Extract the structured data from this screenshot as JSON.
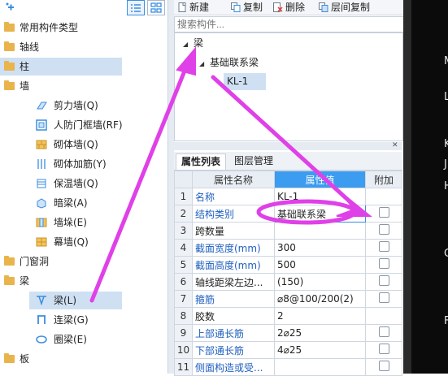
{
  "left_tree": {
    "top_buttons": [
      "plus-icon",
      "list-view-icon",
      "grid-view-icon"
    ],
    "items": [
      {
        "label": "常用构件类型",
        "level": 0,
        "icon": "folder-icon"
      },
      {
        "label": "轴线",
        "level": 0,
        "icon": "folder-icon"
      },
      {
        "label": "柱",
        "level": 0,
        "icon": "folder-icon",
        "selected": true
      },
      {
        "label": "墙",
        "level": 0,
        "icon": "folder-icon"
      },
      {
        "label": "剪力墙(Q)",
        "level": 1,
        "icon": "shear-wall-icon"
      },
      {
        "label": "人防门框墙(RF)",
        "level": 1,
        "icon": "door-frame-wall-icon"
      },
      {
        "label": "砌体墙(Q)",
        "level": 1,
        "icon": "masonry-wall-icon"
      },
      {
        "label": "砌体加筋(Y)",
        "level": 1,
        "icon": "masonry-rebar-icon"
      },
      {
        "label": "保温墙(Q)",
        "level": 1,
        "icon": "insulation-wall-icon"
      },
      {
        "label": "暗梁(A)",
        "level": 1,
        "icon": "hidden-beam-icon"
      },
      {
        "label": "墙垛(E)",
        "level": 1,
        "icon": "wall-pier-icon"
      },
      {
        "label": "幕墙(Q)",
        "level": 1,
        "icon": "curtain-wall-icon"
      },
      {
        "label": "门窗洞",
        "level": 0,
        "icon": "folder-icon"
      },
      {
        "label": "梁",
        "level": 0,
        "icon": "folder-icon"
      },
      {
        "label": "梁(L)",
        "level": 1,
        "icon": "beam-icon",
        "selected": true
      },
      {
        "label": "连梁(G)",
        "level": 1,
        "icon": "coupling-beam-icon"
      },
      {
        "label": "圈梁(E)",
        "level": 1,
        "icon": "ring-beam-icon"
      },
      {
        "label": "板",
        "level": 0,
        "icon": "folder-icon"
      }
    ]
  },
  "toolbar": {
    "new_label": "新建",
    "copy_label": "复制",
    "delete_label": "删除",
    "floor_copy_label": "层间复制"
  },
  "search": {
    "placeholder": "搜索构件..."
  },
  "component_tree": {
    "root": "梁",
    "child": "基础联系梁",
    "leaf": "KL-1"
  },
  "properties": {
    "tabs": [
      "属性列表",
      "图层管理"
    ],
    "headers": {
      "name": "属性名称",
      "value": "属性值",
      "extra": "附加"
    },
    "rows": [
      {
        "no": "1",
        "name": "名称",
        "value": "KL-1",
        "checkbox": false,
        "blue": true
      },
      {
        "no": "2",
        "name": "结构类别",
        "value": "基础联系梁",
        "checkbox": true,
        "blue": true
      },
      {
        "no": "3",
        "name": "跨数量",
        "value": "",
        "checkbox": true,
        "blue": false
      },
      {
        "no": "4",
        "name": "截面宽度(mm)",
        "value": "300",
        "checkbox": true,
        "blue": true
      },
      {
        "no": "5",
        "name": "截面高度(mm)",
        "value": "500",
        "checkbox": true,
        "blue": true
      },
      {
        "no": "6",
        "name": "轴线距梁左边...",
        "value": "(150)",
        "checkbox": true,
        "blue": false
      },
      {
        "no": "7",
        "name": "箍筋",
        "value": "⌀8@100/200(2)",
        "checkbox": true,
        "blue": true
      },
      {
        "no": "8",
        "name": "胶数",
        "value": "2",
        "checkbox": false,
        "blue": false
      },
      {
        "no": "9",
        "name": "上部通长筋",
        "value": "2⌀25",
        "checkbox": true,
        "blue": true
      },
      {
        "no": "10",
        "name": "下部通长筋",
        "value": "4⌀25",
        "checkbox": true,
        "blue": true
      },
      {
        "no": "11",
        "name": "侧面构造或受...",
        "value": "",
        "checkbox": true,
        "blue": true
      }
    ]
  },
  "dark_strip_letters": [
    "M",
    "L",
    "K",
    "J",
    "H",
    "G",
    "F"
  ],
  "colors": {
    "annotation": "#e040e8",
    "selection": "#cfe0f3",
    "header_highlight": "#3b9cf0"
  }
}
